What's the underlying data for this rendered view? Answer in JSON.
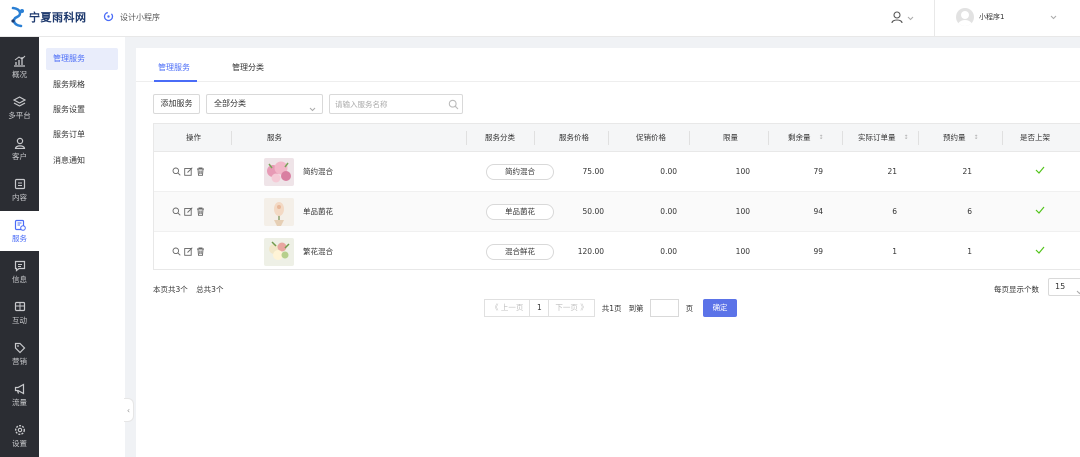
{
  "header": {
    "logo_text": "宁夏雨科网",
    "app_name": "设计小程序",
    "account_name": "小程序1"
  },
  "sidebar": {
    "items": [
      {
        "label": "概况",
        "icon": "chart-icon"
      },
      {
        "label": "多平台",
        "icon": "layers-icon"
      },
      {
        "label": "客户",
        "icon": "user-icon"
      },
      {
        "label": "内容",
        "icon": "document-icon"
      },
      {
        "label": "服务",
        "icon": "service-icon",
        "active": true
      },
      {
        "label": "信息",
        "icon": "message-icon"
      },
      {
        "label": "互动",
        "icon": "interaction-icon"
      },
      {
        "label": "营销",
        "icon": "tag-icon"
      },
      {
        "label": "流量",
        "icon": "megaphone-icon"
      },
      {
        "label": "设置",
        "icon": "gear-icon"
      }
    ]
  },
  "submenu": {
    "items": [
      {
        "label": "管理服务",
        "active": true
      },
      {
        "label": "服务规格"
      },
      {
        "label": "服务设置"
      },
      {
        "label": "服务订单"
      },
      {
        "label": "消息通知"
      }
    ]
  },
  "tabs": [
    {
      "label": "管理服务",
      "active": true
    },
    {
      "label": "管理分类"
    }
  ],
  "toolbar": {
    "add_label": "添加服务",
    "category_select": "全部分类",
    "search_placeholder": "请输入服务名称"
  },
  "table": {
    "headers": [
      "操作",
      "服务",
      "服务分类",
      "服务价格",
      "促销价格",
      "限量",
      "剩余量",
      "实际订单量",
      "预约量",
      "是否上架"
    ],
    "rows": [
      {
        "name": "简约混合",
        "category": "简约混合",
        "price": "75.00",
        "promo": "0.00",
        "limit": "100",
        "remaining": "79",
        "orders": "21",
        "reserved": "21",
        "listed": true
      },
      {
        "name": "单品菌花",
        "category": "单品菌花",
        "price": "50.00",
        "promo": "0.00",
        "limit": "100",
        "remaining": "94",
        "orders": "6",
        "reserved": "6",
        "listed": true
      },
      {
        "name": "繁花混合",
        "category": "混合鲜花",
        "price": "120.00",
        "promo": "0.00",
        "limit": "100",
        "remaining": "99",
        "orders": "1",
        "reserved": "1",
        "listed": true
      }
    ]
  },
  "summary": {
    "page_count_text": "本页共3个",
    "total_text": "总共3个"
  },
  "pagination": {
    "prev_label": "《 上一页",
    "current_page": "1",
    "next_label": "下一页 》",
    "total_pages_text": "共1页",
    "goto_label": "到第",
    "page_suffix": "页",
    "confirm_label": "确定",
    "page_size_label": "每页显示个数",
    "page_size_value": "15"
  },
  "colors": {
    "accent": "#4a6cf7",
    "sidebar_bg": "#2b2d33",
    "check_green": "#52c41a"
  }
}
